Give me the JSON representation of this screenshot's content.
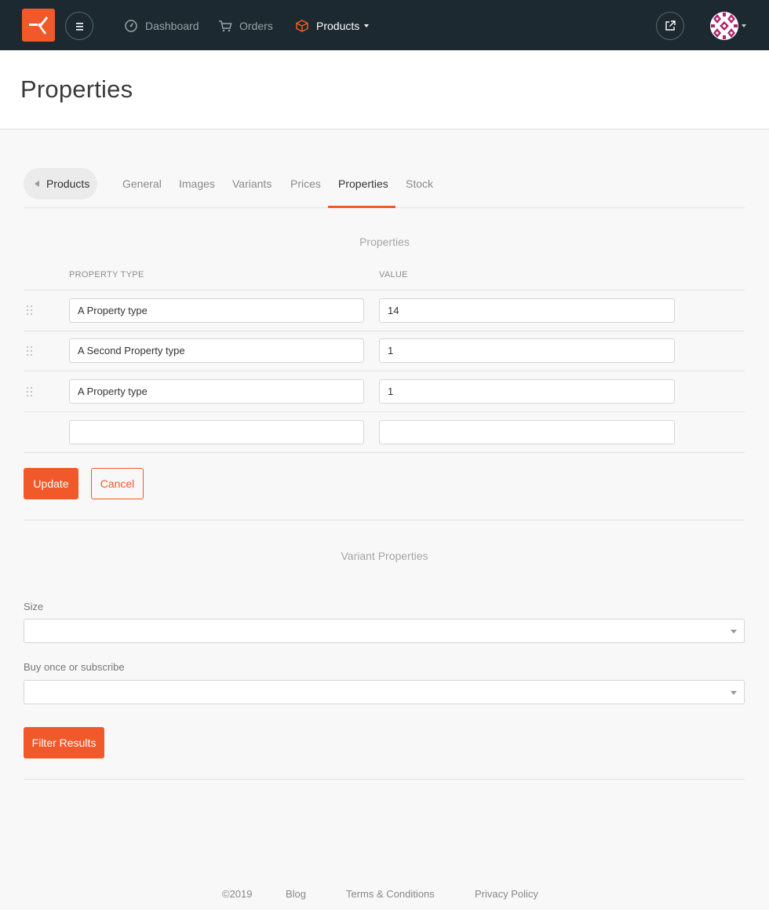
{
  "nav": {
    "items": [
      {
        "label": "Dashboard",
        "icon": "dashboard-icon"
      },
      {
        "label": "Orders",
        "icon": "cart-icon"
      },
      {
        "label": "Products",
        "icon": "box-icon"
      }
    ],
    "accent": "#f2592a",
    "background": "#1c2930"
  },
  "page": {
    "title": "Properties"
  },
  "tabs": {
    "back_label": "Products",
    "items": [
      "General",
      "Images",
      "Variants",
      "Prices",
      "Properties",
      "Stock"
    ],
    "active": "Properties"
  },
  "properties": {
    "section_title": "Properties",
    "col_type": "PROPERTY TYPE",
    "col_value": "VALUE",
    "rows": [
      {
        "type": "A Property type",
        "value": "14"
      },
      {
        "type": "A Second Property type",
        "value": "1"
      },
      {
        "type": "A Property type",
        "value": "1"
      },
      {
        "type": "",
        "value": ""
      }
    ],
    "update_label": "Update",
    "cancel_label": "Cancel"
  },
  "variant_properties": {
    "section_title": "Variant Properties",
    "size_label": "Size",
    "size_value": "",
    "buy_label": "Buy once or subscribe",
    "buy_value": "",
    "filter_label": "Filter Results"
  },
  "footer": {
    "copyright": "©2019",
    "blog": "Blog",
    "terms": "Terms & Conditions",
    "privacy": "Privacy Policy"
  }
}
